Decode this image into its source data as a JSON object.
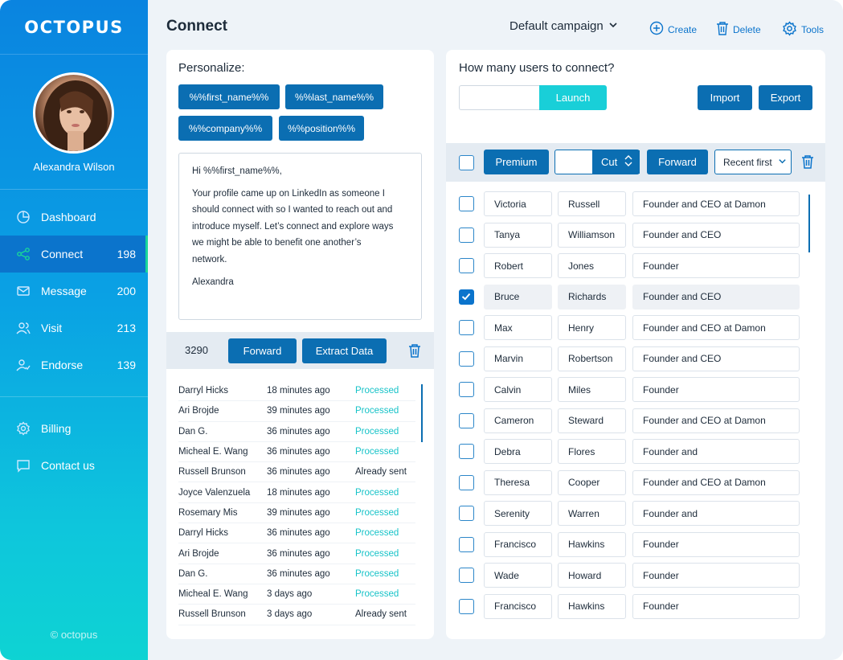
{
  "brand": {
    "logo": "OCTOPUS",
    "copyright": "© octopus"
  },
  "user": {
    "name": "Alexandra Wilson"
  },
  "nav": [
    {
      "label": "Dashboard",
      "count": "",
      "icon": "pie-chart-icon"
    },
    {
      "label": "Connect",
      "count": "198",
      "icon": "share-icon"
    },
    {
      "label": "Message",
      "count": "200",
      "icon": "mail-icon"
    },
    {
      "label": "Visit",
      "count": "213",
      "icon": "users-icon"
    },
    {
      "label": "Endorse",
      "count": "139",
      "icon": "user-check-icon"
    }
  ],
  "nav2": [
    {
      "label": "Billing",
      "icon": "gear-icon"
    },
    {
      "label": "Contact us",
      "icon": "chat-icon"
    }
  ],
  "header": {
    "title": "Connect",
    "campaign": "Default campaign",
    "create": "Create",
    "delete": "Delete",
    "tools": "Tools"
  },
  "personalize": {
    "title": "Personalize:",
    "tags": [
      "%%first_name%%",
      "%%last_name%%",
      "%%company%%",
      "%%position%%"
    ]
  },
  "message": {
    "greeting": "Hi %%first_name%%,",
    "body_lines": [
      "Your profile came up on LinkedIn as someone I",
      "should connect with so I wanted to reach out and",
      "introduce myself. Let’s connect and explore ways",
      "we might be able to benefit one another’s",
      "network."
    ],
    "signature": "Alexandra"
  },
  "left_toolbar": {
    "count": "3290",
    "forward": "Forward",
    "extract": "Extract Data"
  },
  "log": [
    {
      "name": "Darryl Hicks",
      "time": "18 minutes ago",
      "status": "Processed"
    },
    {
      "name": "Ari Brojde",
      "time": "39 minutes ago",
      "status": "Processed"
    },
    {
      "name": "Dan G.",
      "time": "36 minutes ago",
      "status": "Processed"
    },
    {
      "name": "Micheal E. Wang",
      "time": "36 minutes ago",
      "status": "Processed"
    },
    {
      "name": "Russell Brunson",
      "time": "36 minutes ago",
      "status": "Already sent"
    },
    {
      "name": "Joyce Valenzuela",
      "time": "18 minutes ago",
      "status": "Processed"
    },
    {
      "name": "Rosemary Mis",
      "time": "39 minutes ago",
      "status": "Processed"
    },
    {
      "name": "Darryl Hicks",
      "time": "36 minutes ago",
      "status": "Processed"
    },
    {
      "name": "Ari Brojde",
      "time": "36 minutes ago",
      "status": "Processed"
    },
    {
      "name": "Dan G.",
      "time": "36 minutes ago",
      "status": "Processed"
    },
    {
      "name": "Micheal E. Wang",
      "time": "3 days ago",
      "status": "Processed"
    },
    {
      "name": "Russell Brunson",
      "time": "3 days ago",
      "status": "Already sent"
    }
  ],
  "connect": {
    "question": "How many users to connect?",
    "input_value": "",
    "launch": "Launch",
    "import": "Import",
    "export": "Export"
  },
  "right_toolbar": {
    "premium": "Premium",
    "cut": "Cut",
    "forward": "Forward",
    "sort": "Recent first"
  },
  "users": [
    {
      "first": "Victoria",
      "last": "Russell",
      "title": "Founder and CEO at Damon",
      "checked": false
    },
    {
      "first": "Tanya",
      "last": "Williamson",
      "title": "Founder and CEO",
      "checked": false
    },
    {
      "first": "Robert",
      "last": "Jones",
      "title": "Founder",
      "checked": false
    },
    {
      "first": "Bruce",
      "last": "Richards",
      "title": "Founder and CEO",
      "checked": true
    },
    {
      "first": "Max",
      "last": "Henry",
      "title": "Founder and CEO at Damon",
      "checked": false
    },
    {
      "first": "Marvin",
      "last": "Robertson",
      "title": "Founder and CEO",
      "checked": false
    },
    {
      "first": "Calvin",
      "last": "Miles",
      "title": "Founder",
      "checked": false
    },
    {
      "first": "Cameron",
      "last": "Steward",
      "title": "Founder and CEO at Damon",
      "checked": false
    },
    {
      "first": "Debra",
      "last": "Flores",
      "title": "Founder and",
      "checked": false
    },
    {
      "first": "Theresa",
      "last": "Cooper",
      "title": "Founder and CEO at Damon",
      "checked": false
    },
    {
      "first": "Serenity",
      "last": "Warren",
      "title": "Founder and",
      "checked": false
    },
    {
      "first": "Francisco",
      "last": "Hawkins",
      "title": "Founder",
      "checked": false
    },
    {
      "first": "Wade",
      "last": "Howard",
      "title": "Founder",
      "checked": false
    },
    {
      "first": "Francisco",
      "last": "Hawkins",
      "title": "Founder",
      "checked": false
    }
  ],
  "colors": {
    "primary": "#0b6eb2",
    "accent": "#19cfd8",
    "processed": "#17c3c8",
    "active_marker": "#19d69a"
  }
}
